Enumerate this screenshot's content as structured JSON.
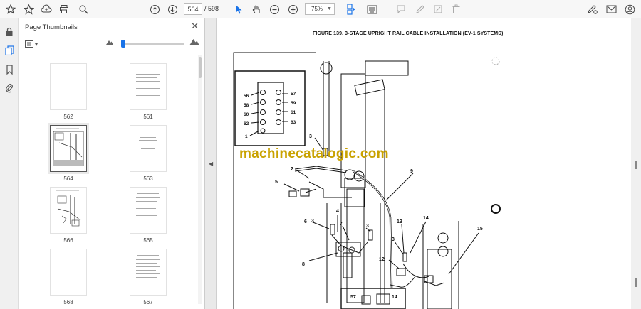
{
  "toolbar": {
    "current_page": "564",
    "total_pages": "/ 598",
    "zoom": "75%"
  },
  "panel": {
    "title": "Page Thumbnails"
  },
  "thumbnails": [
    {
      "label": "562",
      "kind": "blank"
    },
    {
      "label": "561",
      "kind": "table"
    },
    {
      "label": "564",
      "kind": "diagram",
      "selected": true
    },
    {
      "label": "563",
      "kind": "title"
    },
    {
      "label": "566",
      "kind": "diagram"
    },
    {
      "label": "565",
      "kind": "table"
    },
    {
      "label": "568",
      "kind": "blank"
    },
    {
      "label": "567",
      "kind": "table"
    }
  ],
  "document": {
    "figure_title": "FIGURE 139.     3-STAGE UPRIGHT RAIL CABLE INSTALLATION (EV-1 SYSTEMS)",
    "watermark": "machinecatalogic.com",
    "inset_labels_left": [
      "56",
      "58",
      "60",
      "62",
      "1"
    ],
    "inset_labels_right": [
      "57",
      "59",
      "61",
      "63"
    ],
    "callouts": [
      "3",
      "2",
      "9",
      "5",
      "4",
      "7",
      "6",
      "3",
      "3",
      "8",
      "13",
      "14",
      "12",
      "3",
      "15",
      "57",
      "14"
    ]
  },
  "colors": {
    "accent": "#1a73e8",
    "watermark": "#c9a200"
  }
}
